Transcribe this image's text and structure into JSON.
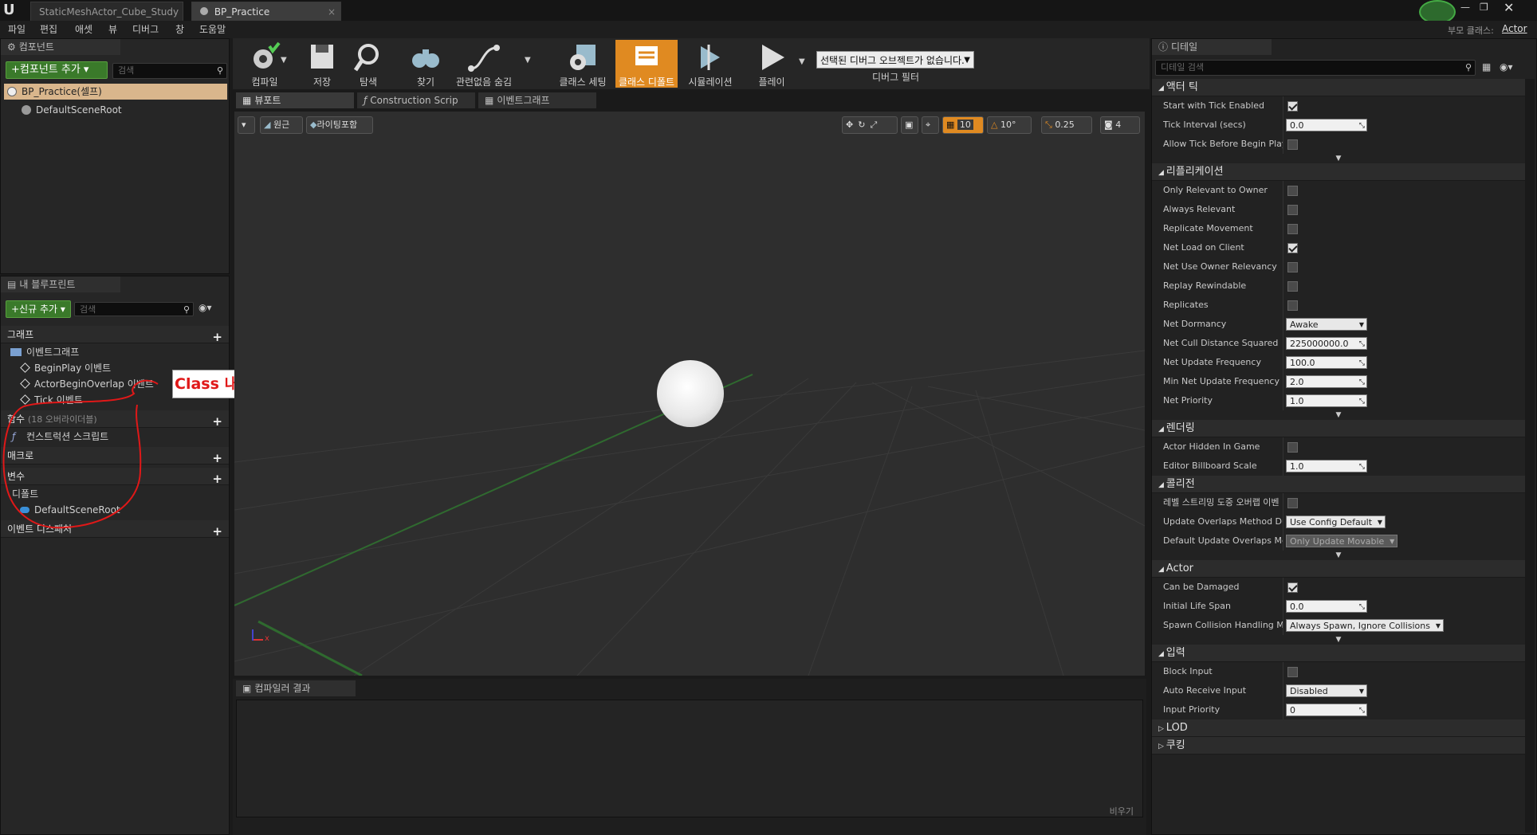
{
  "tabs": [
    {
      "label": "StaticMeshActor_Cube_Study"
    },
    {
      "label": "BP_Practice"
    }
  ],
  "parent_class_label": "부모 클래스:",
  "parent_class_value": "Actor",
  "menu": [
    "파일",
    "편집",
    "애셋",
    "뷰",
    "디버그",
    "창",
    "도움말"
  ],
  "components": {
    "tab": "컴포넌트",
    "add_button": "+컴포넌트 추가",
    "search_placeholder": "검색",
    "self_item": "BP_Practice(셀프)",
    "root_item": "DefaultSceneRoot"
  },
  "myblueprint": {
    "tab": "내 블루프린트",
    "add_button": "+신규 추가",
    "search_placeholder": "검색",
    "graph_header": "그래프",
    "event_graph": "이벤트그래프",
    "events": [
      "BeginPlay 이벤트",
      "ActorBeginOverlap 이벤트",
      "Tick 이벤트"
    ],
    "functions_header": "함수",
    "functions_overridable": "(18 오버라이더블)",
    "construction_script": "컨스트럭션 스크립트",
    "macros_header": "매크로",
    "variables_header": "변수",
    "default_category": "디폴트",
    "default_root": "DefaultSceneRoot",
    "dispatchers_header": "이벤트 디스패처"
  },
  "annotation": {
    "text": "Class 내부의 멤버 함수 / 변수",
    "color": "#e01818"
  },
  "toolbar": [
    {
      "label": "컴파일",
      "icon": "gear-check-icon"
    },
    {
      "label": "저장",
      "icon": "save-icon"
    },
    {
      "label": "탐색",
      "icon": "magnifier-icon"
    },
    {
      "label": "찾기",
      "icon": "binoculars-icon"
    },
    {
      "label": "관련없음 숨김",
      "icon": "graph-node-icon"
    },
    {
      "label": "클래스 세팅",
      "icon": "class-gear-icon"
    },
    {
      "label": "클래스 디폴트",
      "icon": "class-defaults-icon"
    },
    {
      "label": "시뮬레이션",
      "icon": "simulate-icon"
    },
    {
      "label": "플레이",
      "icon": "play-icon"
    }
  ],
  "debug_dropdown": "선택된 디버그 오브젝트가 없습니다.",
  "debug_filter_label": "디버그 필터",
  "editor_tabs": [
    "뷰포트",
    "Construction Scrip",
    "이벤트그래프"
  ],
  "viewport_toolbar": {
    "perspective": "원근",
    "lighting": "라이팅포함",
    "grid_snap": "10",
    "rot_snap": "10°",
    "scale_snap": "0.25",
    "cam_speed": "4"
  },
  "compiler": {
    "tab": "컴파일러 결과",
    "clear": "비우기"
  },
  "details": {
    "tab": "디테일",
    "search_placeholder": "디테일 검색",
    "sections": [
      {
        "title": "액터 틱",
        "rows": [
          {
            "label": "Start with Tick Enabled",
            "type": "check",
            "value": true
          },
          {
            "label": "Tick Interval (secs)",
            "type": "num",
            "value": "0.0"
          },
          {
            "label": "Allow Tick Before Begin Play",
            "type": "check",
            "value": false
          }
        ]
      },
      {
        "title": "리플리케이션",
        "rows": [
          {
            "label": "Only Relevant to Owner",
            "type": "check",
            "value": false
          },
          {
            "label": "Always Relevant",
            "type": "check",
            "value": false
          },
          {
            "label": "Replicate Movement",
            "type": "check",
            "value": false
          },
          {
            "label": "Net Load on Client",
            "type": "check",
            "value": true
          },
          {
            "label": "Net Use Owner Relevancy",
            "type": "check",
            "value": false
          },
          {
            "label": "Replay Rewindable",
            "type": "check",
            "value": false
          },
          {
            "label": "Replicates",
            "type": "check",
            "value": false
          },
          {
            "label": "Net Dormancy",
            "type": "sel",
            "value": "Awake"
          },
          {
            "label": "Net Cull Distance Squared",
            "type": "num",
            "value": "225000000.0"
          },
          {
            "label": "Net Update Frequency",
            "type": "num",
            "value": "100.0"
          },
          {
            "label": "Min Net Update Frequency",
            "type": "num",
            "value": "2.0"
          },
          {
            "label": "Net Priority",
            "type": "num",
            "value": "1.0"
          }
        ]
      },
      {
        "title": "렌더링",
        "rows": [
          {
            "label": "Actor Hidden In Game",
            "type": "check",
            "value": false
          },
          {
            "label": "Editor Billboard Scale",
            "type": "num",
            "value": "1.0"
          }
        ]
      },
      {
        "title": "콜리전",
        "rows": [
          {
            "label": "레벨 스트리밍 도중 오버랩 이벤",
            "type": "check",
            "value": false
          },
          {
            "label": "Update Overlaps Method Dur",
            "type": "sel",
            "value": "Use Config Default"
          },
          {
            "label": "Default Update Overlaps Met",
            "type": "seldim",
            "value": "Only Update Movable"
          }
        ]
      },
      {
        "title": "Actor",
        "rows": [
          {
            "label": "Can be Damaged",
            "type": "check",
            "value": true
          },
          {
            "label": "Initial Life Span",
            "type": "num",
            "value": "0.0"
          },
          {
            "label": "Spawn Collision Handling Me",
            "type": "sel",
            "value": "Always Spawn, Ignore Collisions"
          }
        ]
      },
      {
        "title": "입력",
        "rows": [
          {
            "label": "Block Input",
            "type": "check",
            "value": false
          },
          {
            "label": "Auto Receive Input",
            "type": "sel",
            "value": "Disabled"
          },
          {
            "label": "Input Priority",
            "type": "num",
            "value": "0"
          }
        ]
      },
      {
        "title": "LOD",
        "rows": []
      },
      {
        "title": "쿠킹",
        "rows": []
      }
    ]
  }
}
